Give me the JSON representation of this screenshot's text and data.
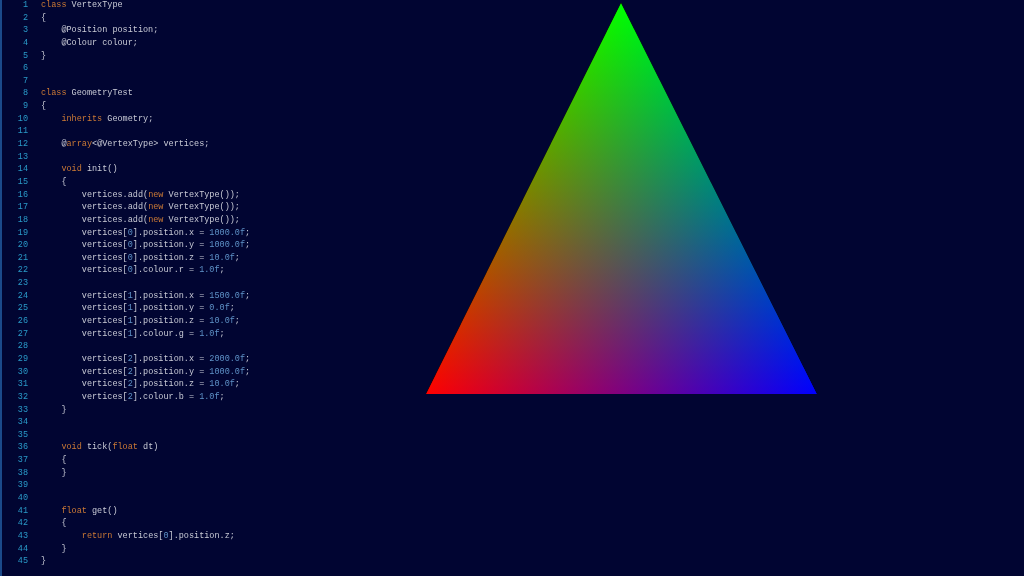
{
  "editor": {
    "lines": [
      {
        "number": "1",
        "tokens": [
          {
            "kind": "keyword",
            "text": "class"
          },
          {
            "kind": "plain",
            "text": " VertexType"
          }
        ]
      },
      {
        "number": "2",
        "tokens": [
          {
            "kind": "plain",
            "text": "{"
          }
        ]
      },
      {
        "number": "3",
        "tokens": [
          {
            "kind": "plain",
            "text": "    @Position position;"
          }
        ]
      },
      {
        "number": "4",
        "tokens": [
          {
            "kind": "plain",
            "text": "    @Colour colour;"
          }
        ]
      },
      {
        "number": "5",
        "tokens": [
          {
            "kind": "plain",
            "text": "}"
          }
        ]
      },
      {
        "number": "6"
      },
      {
        "number": "7"
      },
      {
        "number": "8",
        "tokens": [
          {
            "kind": "keyword",
            "text": "class"
          },
          {
            "kind": "plain",
            "text": " GeometryTest"
          }
        ]
      },
      {
        "number": "9",
        "tokens": [
          {
            "kind": "plain",
            "text": "{"
          }
        ]
      },
      {
        "number": "10",
        "tokens": [
          {
            "kind": "keyword",
            "text": "    inherits"
          },
          {
            "kind": "plain",
            "text": " Geometry;"
          }
        ]
      },
      {
        "number": "11"
      },
      {
        "number": "12",
        "tokens": [
          {
            "kind": "plain",
            "text": "    @"
          },
          {
            "kind": "keyword",
            "text": "array"
          },
          {
            "kind": "plain",
            "text": "<@VertexType> vertices;"
          }
        ]
      },
      {
        "number": "13"
      },
      {
        "number": "14",
        "tokens": [
          {
            "kind": "keyword",
            "text": "    void"
          },
          {
            "kind": "plain",
            "text": " init()"
          }
        ]
      },
      {
        "number": "15",
        "tokens": [
          {
            "kind": "plain",
            "text": "    {"
          }
        ]
      },
      {
        "number": "16",
        "tokens": [
          {
            "kind": "plain",
            "text": "        vertices.add("
          },
          {
            "kind": "keyword",
            "text": "new"
          },
          {
            "kind": "plain",
            "text": " VertexType());"
          }
        ]
      },
      {
        "number": "17",
        "tokens": [
          {
            "kind": "plain",
            "text": "        vertices.add("
          },
          {
            "kind": "keyword",
            "text": "new"
          },
          {
            "kind": "plain",
            "text": " VertexType());"
          }
        ]
      },
      {
        "number": "18",
        "tokens": [
          {
            "kind": "plain",
            "text": "        vertices.add("
          },
          {
            "kind": "keyword",
            "text": "new"
          },
          {
            "kind": "plain",
            "text": " VertexType());"
          }
        ]
      },
      {
        "number": "19",
        "tokens": [
          {
            "kind": "plain",
            "text": "        vertices["
          },
          {
            "kind": "number",
            "text": "0"
          },
          {
            "kind": "plain",
            "text": "].position.x = "
          },
          {
            "kind": "number",
            "text": "1000.0f"
          },
          {
            "kind": "plain",
            "text": ";"
          }
        ]
      },
      {
        "number": "20",
        "tokens": [
          {
            "kind": "plain",
            "text": "        vertices["
          },
          {
            "kind": "number",
            "text": "0"
          },
          {
            "kind": "plain",
            "text": "].position.y = "
          },
          {
            "kind": "number",
            "text": "1000.0f"
          },
          {
            "kind": "plain",
            "text": ";"
          }
        ]
      },
      {
        "number": "21",
        "tokens": [
          {
            "kind": "plain",
            "text": "        vertices["
          },
          {
            "kind": "number",
            "text": "0"
          },
          {
            "kind": "plain",
            "text": "].position.z = "
          },
          {
            "kind": "number",
            "text": "10.0f"
          },
          {
            "kind": "plain",
            "text": ";"
          }
        ]
      },
      {
        "number": "22",
        "tokens": [
          {
            "kind": "plain",
            "text": "        vertices["
          },
          {
            "kind": "number",
            "text": "0"
          },
          {
            "kind": "plain",
            "text": "].colour.r = "
          },
          {
            "kind": "number",
            "text": "1.0f"
          },
          {
            "kind": "plain",
            "text": ";"
          }
        ]
      },
      {
        "number": "23"
      },
      {
        "number": "24",
        "tokens": [
          {
            "kind": "plain",
            "text": "        vertices["
          },
          {
            "kind": "number",
            "text": "1"
          },
          {
            "kind": "plain",
            "text": "].position.x = "
          },
          {
            "kind": "number",
            "text": "1500.0f"
          },
          {
            "kind": "plain",
            "text": ";"
          }
        ]
      },
      {
        "number": "25",
        "tokens": [
          {
            "kind": "plain",
            "text": "        vertices["
          },
          {
            "kind": "number",
            "text": "1"
          },
          {
            "kind": "plain",
            "text": "].position.y = "
          },
          {
            "kind": "number",
            "text": "0.0f"
          },
          {
            "kind": "plain",
            "text": ";"
          }
        ]
      },
      {
        "number": "26",
        "tokens": [
          {
            "kind": "plain",
            "text": "        vertices["
          },
          {
            "kind": "number",
            "text": "1"
          },
          {
            "kind": "plain",
            "text": "].position.z = "
          },
          {
            "kind": "number",
            "text": "10.0f"
          },
          {
            "kind": "plain",
            "text": ";"
          }
        ]
      },
      {
        "number": "27",
        "tokens": [
          {
            "kind": "plain",
            "text": "        vertices["
          },
          {
            "kind": "number",
            "text": "1"
          },
          {
            "kind": "plain",
            "text": "].colour.g = "
          },
          {
            "kind": "number",
            "text": "1.0f"
          },
          {
            "kind": "plain",
            "text": ";"
          }
        ]
      },
      {
        "number": "28"
      },
      {
        "number": "29",
        "tokens": [
          {
            "kind": "plain",
            "text": "        vertices["
          },
          {
            "kind": "number",
            "text": "2"
          },
          {
            "kind": "plain",
            "text": "].position.x = "
          },
          {
            "kind": "number",
            "text": "2000.0f"
          },
          {
            "kind": "plain",
            "text": ";"
          }
        ]
      },
      {
        "number": "30",
        "tokens": [
          {
            "kind": "plain",
            "text": "        vertices["
          },
          {
            "kind": "number",
            "text": "2"
          },
          {
            "kind": "plain",
            "text": "].position.y = "
          },
          {
            "kind": "number",
            "text": "1000.0f"
          },
          {
            "kind": "plain",
            "text": ";"
          }
        ]
      },
      {
        "number": "31",
        "tokens": [
          {
            "kind": "plain",
            "text": "        vertices["
          },
          {
            "kind": "number",
            "text": "2"
          },
          {
            "kind": "plain",
            "text": "].position.z = "
          },
          {
            "kind": "number",
            "text": "10.0f"
          },
          {
            "kind": "plain",
            "text": ";"
          }
        ]
      },
      {
        "number": "32",
        "tokens": [
          {
            "kind": "plain",
            "text": "        vertices["
          },
          {
            "kind": "number",
            "text": "2"
          },
          {
            "kind": "plain",
            "text": "].colour.b = "
          },
          {
            "kind": "number",
            "text": "1.0f"
          },
          {
            "kind": "plain",
            "text": ";"
          }
        ]
      },
      {
        "number": "33",
        "tokens": [
          {
            "kind": "plain",
            "text": "    }"
          }
        ]
      },
      {
        "number": "34"
      },
      {
        "number": "35"
      },
      {
        "number": "36",
        "tokens": [
          {
            "kind": "keyword",
            "text": "    void"
          },
          {
            "kind": "plain",
            "text": " tick("
          },
          {
            "kind": "keyword",
            "text": "float"
          },
          {
            "kind": "plain",
            "text": " dt)"
          }
        ]
      },
      {
        "number": "37",
        "tokens": [
          {
            "kind": "plain",
            "text": "    {"
          }
        ]
      },
      {
        "number": "38",
        "tokens": [
          {
            "kind": "plain",
            "text": "    }"
          }
        ]
      },
      {
        "number": "39"
      },
      {
        "number": "40"
      },
      {
        "number": "41",
        "tokens": [
          {
            "kind": "keyword",
            "text": "    float"
          },
          {
            "kind": "plain",
            "text": " get()"
          }
        ]
      },
      {
        "number": "42",
        "tokens": [
          {
            "kind": "plain",
            "text": "    {"
          }
        ]
      },
      {
        "number": "43",
        "tokens": [
          {
            "kind": "keyword",
            "text": "        return"
          },
          {
            "kind": "plain",
            "text": " vertices["
          },
          {
            "kind": "number",
            "text": "0"
          },
          {
            "kind": "plain",
            "text": "].position.z;"
          }
        ]
      },
      {
        "number": "44",
        "tokens": [
          {
            "kind": "plain",
            "text": "    }"
          }
        ]
      },
      {
        "number": "45",
        "tokens": [
          {
            "kind": "plain",
            "text": "}"
          }
        ]
      }
    ]
  }
}
